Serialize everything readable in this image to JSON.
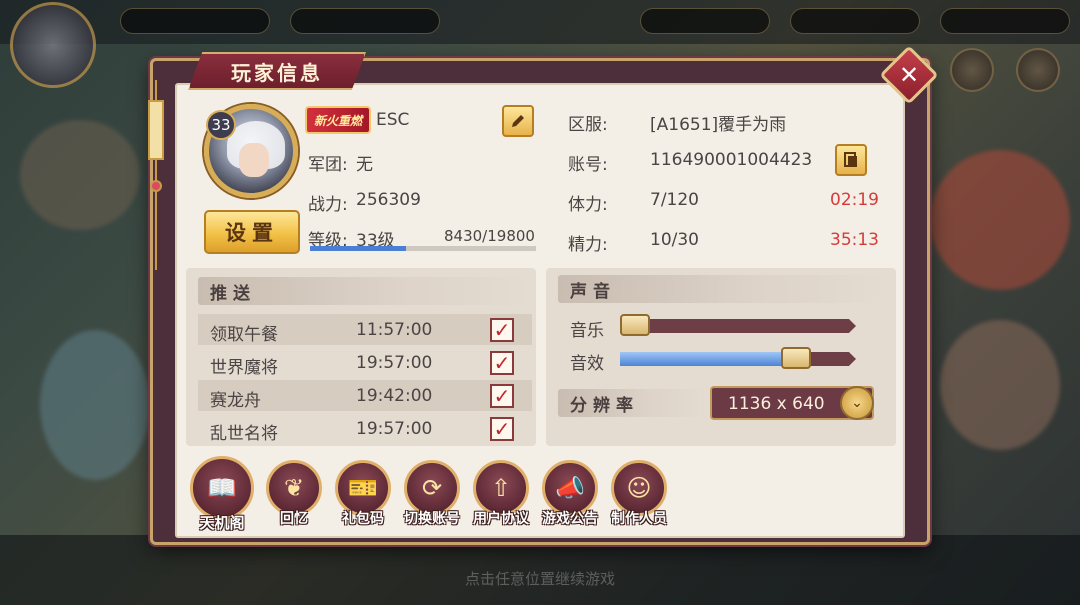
{
  "panel": {
    "title": "玩家信息",
    "close_icon": "close-icon"
  },
  "profile": {
    "level_badge": "33",
    "vip_badge": "新火重燃",
    "name": "ESC",
    "guild_label": "军团:",
    "guild_value": "无",
    "power_label": "战力:",
    "power_value": "256309",
    "level_label": "等级:",
    "level_value": "33级",
    "exp_text": "8430/19800",
    "exp_fraction": 0.4258,
    "settings_label": "设置"
  },
  "account": {
    "server_label": "区服:",
    "server_value": "[A1651]覆手为雨",
    "account_label": "账号:",
    "account_value": "116490001004423",
    "stamina_label": "体力:",
    "stamina_value": "7/120",
    "stamina_timer": "02:19",
    "energy_label": "精力:",
    "energy_value": "10/30",
    "energy_timer": "35:13"
  },
  "push": {
    "title": "推送",
    "items": [
      {
        "name": "领取午餐",
        "time": "11:57:00",
        "checked": true
      },
      {
        "name": "世界魔将",
        "time": "19:57:00",
        "checked": true
      },
      {
        "name": "赛龙舟",
        "time": "19:42:00",
        "checked": true
      },
      {
        "name": "乱世名将",
        "time": "19:57:00",
        "checked": true
      }
    ]
  },
  "sound": {
    "title": "声音",
    "music_label": "音乐",
    "music_level": 0.0,
    "effect_label": "音效",
    "effect_level": 0.82,
    "resolution_label": "分辨率",
    "resolution_value": "1136 x 640"
  },
  "bottom_buttons": [
    {
      "label": "天机阁",
      "icon": "book-icon"
    },
    {
      "label": "回忆",
      "icon": "leaf-icon"
    },
    {
      "label": "礼包码",
      "icon": "ticket-icon"
    },
    {
      "label": "切换账号",
      "icon": "refresh-icon"
    },
    {
      "label": "用户协议",
      "icon": "arrow-up-icon"
    },
    {
      "label": "游戏公告",
      "icon": "megaphone-icon"
    },
    {
      "label": "制作人员",
      "icon": "mascot-icon"
    }
  ],
  "background": {
    "hint": "点击任意位置继续游戏"
  },
  "colors": {
    "panel_border": "#c8a46a",
    "panel_frame": "#4c2f3a",
    "panel_paper": "#f4efe6",
    "timer_red": "#d53b3b",
    "exp_blue": "#4b7fd3",
    "button_gold": "#f2c148"
  }
}
